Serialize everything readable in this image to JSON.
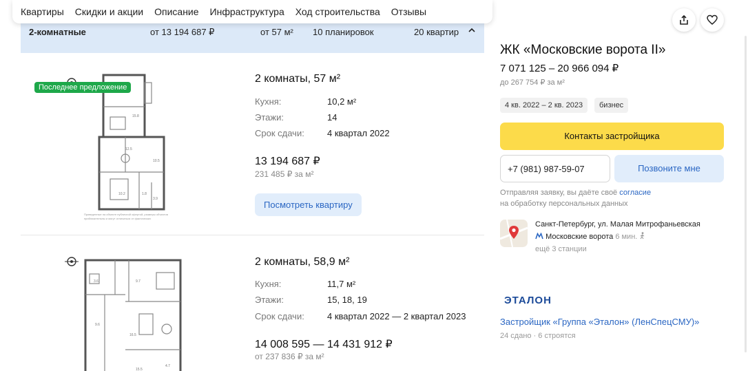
{
  "nav": {
    "items": [
      "Квартиры",
      "Скидки и акции",
      "Описание",
      "Инфраструктура",
      "Ход строительства",
      "Отзывы"
    ]
  },
  "rooms_bar": {
    "type": "2-комнатные",
    "price_from": "от 13 194 687 ₽",
    "area_from": "от 57 м²",
    "layouts": "10 планировок",
    "count": "20 квартир"
  },
  "listings": [
    {
      "badge": "Последнее предложение",
      "title": "2 комнаты, 57 м²",
      "kitchen_label": "Кухня:",
      "kitchen_value": "10,2 м²",
      "floors_label": "Этажи:",
      "floors_value": "14",
      "deadline_label": "Срок сдачи:",
      "deadline_value": "4 квартал 2022",
      "price": "13 194 687 ₽",
      "price_per_m2": "231 485 ₽ за м²",
      "view_button": "Посмотреть квартиру"
    },
    {
      "title": "2 комнаты, 58,9 м²",
      "kitchen_label": "Кухня:",
      "kitchen_value": "11,7 м²",
      "floors_label": "Этажи:",
      "floors_value": "15, 18, 19",
      "deadline_label": "Срок сдачи:",
      "deadline_value": "4 квартал 2022 — 2 квартал 2023",
      "price": "14 008 595 — 14 431 912 ₽",
      "price_per_m2": "от 237 836 ₽ за м²"
    }
  ],
  "complex": {
    "title": "ЖК «Московские ворота II»",
    "price_range": "7 071 125 – 20 966 094 ₽",
    "price_per_m2": "до 267 754 ₽ за м²",
    "tags": [
      "4 кв. 2022 – 2 кв. 2023",
      "бизнес"
    ]
  },
  "contact": {
    "button": "Контакты застройщика",
    "phone": "+7 (981) 987-59-07",
    "call_me": "Позвоните мне",
    "consent_before": "Отправляя заявку, вы даёте своё",
    "consent_link": "согласие",
    "consent_after": "на обработку персональных данных"
  },
  "location": {
    "address": "Санкт-Петербург, ул. Малая Митрофаньевская",
    "metro_station": "Московские ворота",
    "metro_time": "6 мин.",
    "more_stations": "ещё 3 станции"
  },
  "developer": {
    "logo_text": "ЭТАЛОН",
    "name": "Застройщик «Группа «Эталон» (ЛенСпецСМУ)»",
    "stats": "24 сдано · 6 строятся"
  },
  "colors": {
    "accent_blue": "#2a66c3",
    "yellow_button": "#fcdb4a",
    "badge_green": "#1ea84a",
    "bar_blue": "#dce9f8"
  },
  "icons": [
    "share-icon",
    "heart-icon",
    "chevron-up-icon",
    "compass-icon",
    "map-pin-icon",
    "metro-icon",
    "walk-icon"
  ]
}
